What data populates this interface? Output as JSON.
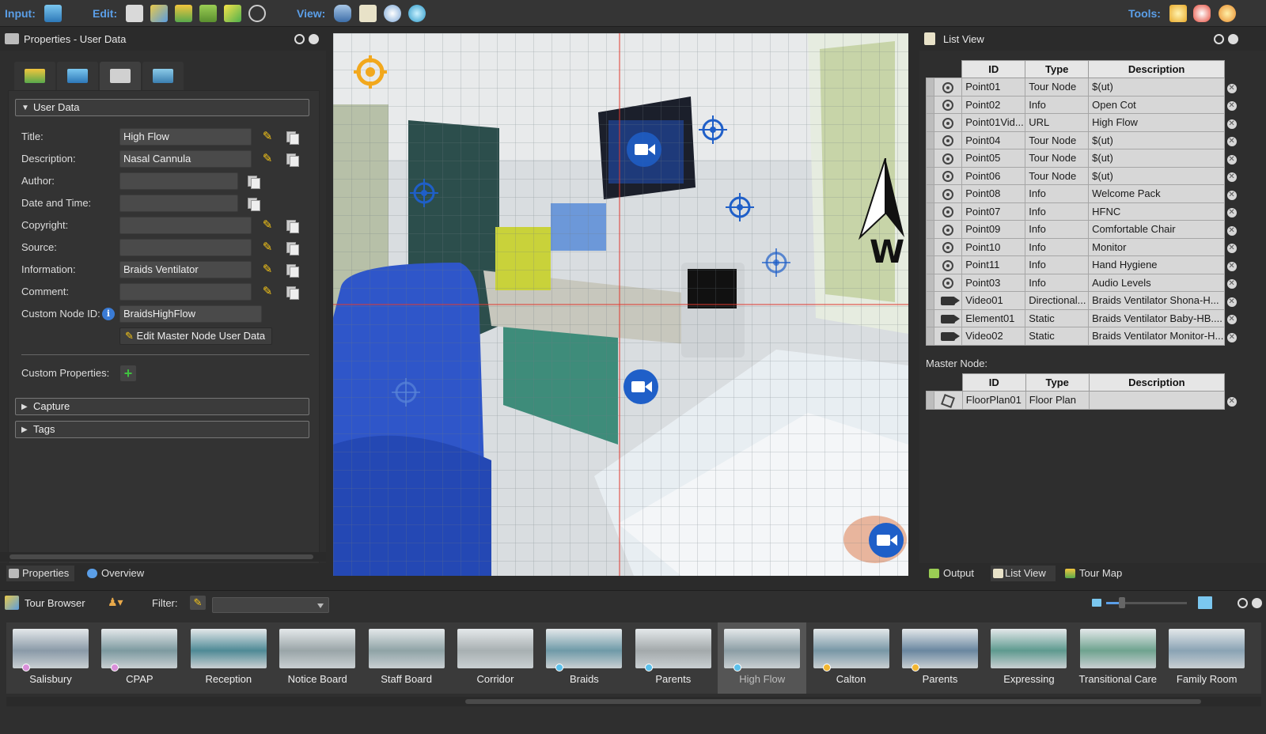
{
  "toolbar": {
    "input_label": "Input:",
    "edit_label": "Edit:",
    "view_label": "View:",
    "tools_label": "Tools:"
  },
  "properties": {
    "panel_title": "Properties - User Data",
    "section_user_data": "User Data",
    "labels": {
      "title": "Title:",
      "description": "Description:",
      "author": "Author:",
      "date_time": "Date and Time:",
      "copyright": "Copyright:",
      "source": "Source:",
      "information": "Information:",
      "comment": "Comment:",
      "custom_node_id": "Custom Node ID:",
      "custom_properties": "Custom Properties:"
    },
    "values": {
      "title": "High Flow",
      "description": "Nasal Cannula",
      "author": "",
      "date_time": "",
      "copyright": "",
      "source": "",
      "information": "Braids Ventilator",
      "comment": "",
      "custom_node_id": "BraidsHighFlow"
    },
    "edit_master_button": "Edit Master Node User Data",
    "section_capture": "Capture",
    "section_tags": "Tags"
  },
  "left_tabs": {
    "properties": "Properties",
    "overview": "Overview"
  },
  "viewport": {
    "compass_letter": "W"
  },
  "list_view": {
    "title": "List View",
    "columns": [
      "ID",
      "Type",
      "Description"
    ],
    "rows": [
      {
        "icon": "crosshair",
        "id": "Point01",
        "type": "Tour Node",
        "description": "$(ut)"
      },
      {
        "icon": "crosshair",
        "id": "Point02",
        "type": "Info",
        "description": "Open Cot"
      },
      {
        "icon": "crosshair",
        "id": "Point01Vid...",
        "type": "URL",
        "description": "High Flow"
      },
      {
        "icon": "crosshair",
        "id": "Point04",
        "type": "Tour Node",
        "description": "$(ut)"
      },
      {
        "icon": "crosshair",
        "id": "Point05",
        "type": "Tour Node",
        "description": "$(ut)"
      },
      {
        "icon": "crosshair",
        "id": "Point06",
        "type": "Tour Node",
        "description": "$(ut)"
      },
      {
        "icon": "crosshair",
        "id": "Point08",
        "type": "Info",
        "description": "Welcome Pack"
      },
      {
        "icon": "crosshair",
        "id": "Point07",
        "type": "Info",
        "description": "HFNC"
      },
      {
        "icon": "crosshair",
        "id": "Point09",
        "type": "Info",
        "description": "Comfortable Chair"
      },
      {
        "icon": "crosshair",
        "id": "Point10",
        "type": "Info",
        "description": "Monitor"
      },
      {
        "icon": "crosshair",
        "id": "Point11",
        "type": "Info",
        "description": "Hand Hygiene"
      },
      {
        "icon": "crosshair",
        "id": "Point03",
        "type": "Info",
        "description": "Audio Levels"
      },
      {
        "icon": "camera",
        "id": "Video01",
        "type": "Directional...",
        "description": "Braids Ventilator Shona-H..."
      },
      {
        "icon": "camera",
        "id": "Element01",
        "type": "Static",
        "description": "Braids Ventilator Baby-HB...."
      },
      {
        "icon": "camera",
        "id": "Video02",
        "type": "Static",
        "description": "Braids Ventilator Monitor-H..."
      }
    ],
    "master_node_label": "Master Node:",
    "master_rows": [
      {
        "icon": "floorplan",
        "id": "FloorPlan01",
        "type": "Floor Plan",
        "description": ""
      }
    ]
  },
  "right_tabs": {
    "output": "Output",
    "list_view": "List View",
    "tour_map": "Tour Map"
  },
  "tour_browser": {
    "title": "Tour Browser",
    "filter_label": "Filter:",
    "filter_value": "",
    "nodes": [
      {
        "name": "Salisbury",
        "dot": "#d98fd9",
        "tone": "#8a9aa8",
        "selected": false
      },
      {
        "name": "CPAP",
        "dot": "#d98fd9",
        "tone": "#7d9aa0",
        "selected": false
      },
      {
        "name": "Reception",
        "dot": "",
        "tone": "#4f8a96",
        "selected": false
      },
      {
        "name": "Notice Board",
        "dot": "",
        "tone": "#9aa5a8",
        "selected": false
      },
      {
        "name": "Staff Board",
        "dot": "",
        "tone": "#8fa3a6",
        "selected": false
      },
      {
        "name": "Corridor",
        "dot": "",
        "tone": "#a8b0b2",
        "selected": false
      },
      {
        "name": "Braids",
        "dot": "#5bc0eb",
        "tone": "#6f9aa8",
        "selected": false
      },
      {
        "name": "Parents",
        "dot": "#5bc0eb",
        "tone": "#a3a9ab",
        "selected": false
      },
      {
        "name": "High Flow",
        "dot": "#5bc0eb",
        "tone": "#8c9ea5",
        "selected": true
      },
      {
        "name": "Calton",
        "dot": "#f2b632",
        "tone": "#7897a6",
        "selected": false
      },
      {
        "name": "Parents",
        "dot": "#f2b632",
        "tone": "#6a87a0",
        "selected": false
      },
      {
        "name": "Expressing",
        "dot": "",
        "tone": "#5e9a8f",
        "selected": false
      },
      {
        "name": "Transitional Care",
        "dot": "",
        "tone": "#6fa38f",
        "selected": false
      },
      {
        "name": "Family Room",
        "dot": "",
        "tone": "#8aa3b4",
        "selected": false
      }
    ]
  },
  "colors": {
    "accent_blue": "#5b9fe8",
    "hotspot_blue": "#1f5fc8",
    "hotspot_orange": "#f2a81d",
    "pencil_yellow": "#f5c518"
  }
}
